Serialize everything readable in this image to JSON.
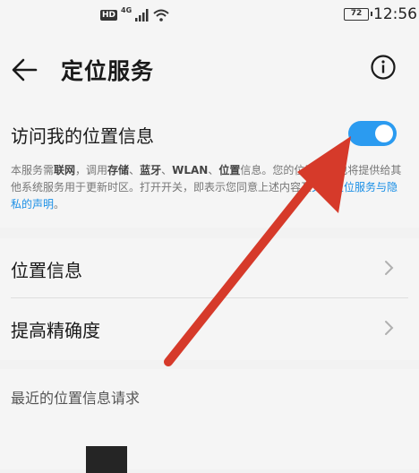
{
  "status_bar": {
    "hd_badge": "HD",
    "network": "4G",
    "battery": "72",
    "time": "12:56"
  },
  "header": {
    "title": "定位服务"
  },
  "location_access": {
    "label": "访问我的位置信息",
    "enabled": true,
    "desc_part1": "本服务需",
    "desc_b1": "联网",
    "desc_part2": "，调用",
    "desc_b2": "存储",
    "desc_sep1": "、",
    "desc_b3": "蓝牙",
    "desc_sep2": "、",
    "desc_b4": "WLAN",
    "desc_sep3": "、",
    "desc_b5": "位置",
    "desc_part3": "信息。您的位置信息也将提供给其他系统服务用于更新时区。打开开关，即表示您同意上述内容及",
    "desc_link": "关于定位服务与隐私的声明",
    "desc_end": "。"
  },
  "menu": {
    "item1": "位置信息",
    "item2": "提高精确度"
  },
  "recent": {
    "heading": "最近的位置信息请求"
  },
  "colors": {
    "accent": "#2b9bf0",
    "annotation_arrow": "#d63a2a"
  }
}
